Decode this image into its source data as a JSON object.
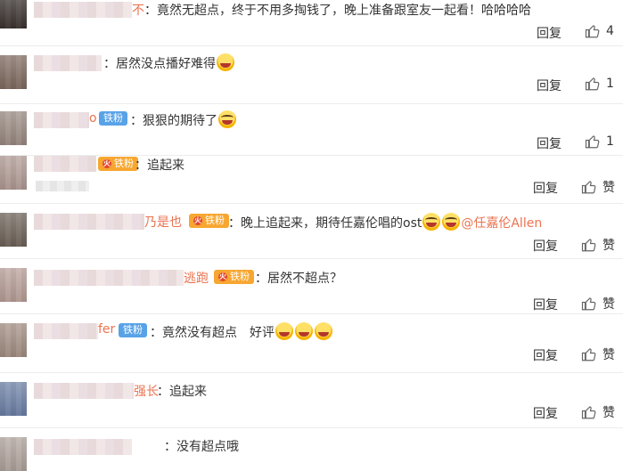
{
  "labels": {
    "reply": "回复",
    "zan": "赞"
  },
  "colors": {
    "link": "#eb7350",
    "badge_blue": "#58a2e7",
    "badge_orange": "#f7a731"
  },
  "comments": [
    {
      "name_visible": "不",
      "badge": "",
      "text": "：竟然无超点，终于不用多掏钱了，晚上准备跟室友一起看！哈哈哈哈",
      "emojis": [],
      "mention": "",
      "like_count": "4"
    },
    {
      "name_visible": "",
      "badge": "",
      "text": "：居然没点播好难得",
      "emojis": [
        "laugh-emoji"
      ],
      "mention": "",
      "like_count": "1"
    },
    {
      "name_visible": "o",
      "badge": "铁粉",
      "text": "：狠狠的期待了",
      "emojis": [
        "cry-emoji"
      ],
      "mention": "",
      "like_count": "1"
    },
    {
      "name_visible": "",
      "badge": "铁粉",
      "text": "：追起来",
      "emojis": [],
      "mention": "",
      "like_count": ""
    },
    {
      "name_visible": "乃是也",
      "badge": "铁粉",
      "text": "：晚上追起来，期待任嘉伦唱的ost",
      "emojis": [
        "cry-emoji",
        "cry-emoji"
      ],
      "mention": "@任嘉伦Allen",
      "like_count": ""
    },
    {
      "name_visible": "逃跑",
      "badge": "铁粉",
      "text": "：居然不超点？",
      "emojis": [],
      "mention": "",
      "like_count": ""
    },
    {
      "name_visible": "fer",
      "badge": "铁粉",
      "text": "：竟然没有超点　好评",
      "emojis": [
        "laugh-emoji",
        "laugh-emoji",
        "laugh-emoji"
      ],
      "mention": "",
      "like_count": ""
    },
    {
      "name_visible": "强长",
      "badge": "",
      "text": "：追起来",
      "emojis": [],
      "mention": "",
      "like_count": ""
    },
    {
      "name_visible": "",
      "badge": "",
      "text": "：没有超点哦",
      "emojis": [],
      "mention": "",
      "like_count": ""
    }
  ]
}
